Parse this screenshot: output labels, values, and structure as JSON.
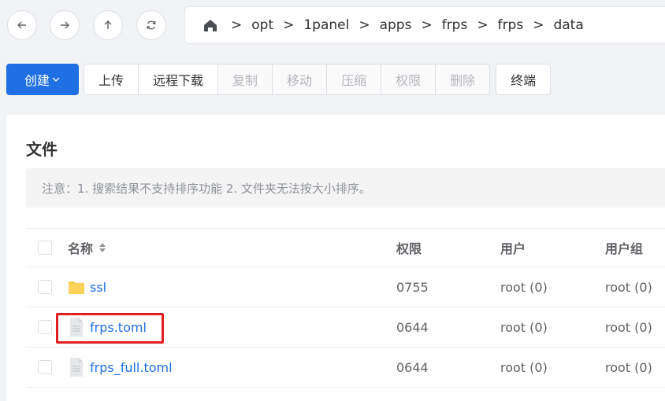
{
  "path": {
    "segments": [
      "opt",
      "1panel",
      "apps",
      "frps",
      "frps",
      "data"
    ],
    "separator": ">"
  },
  "toolbar": {
    "create_label": "创建",
    "buttons": [
      {
        "label": "上传",
        "disabled": false
      },
      {
        "label": "远程下载",
        "disabled": false
      },
      {
        "label": "复制",
        "disabled": true
      },
      {
        "label": "移动",
        "disabled": true
      },
      {
        "label": "压缩",
        "disabled": true
      },
      {
        "label": "权限",
        "disabled": true
      },
      {
        "label": "删除",
        "disabled": true
      }
    ],
    "terminal_label": "终端"
  },
  "main": {
    "title": "文件",
    "notice": "注意：1. 搜索结果不支持排序功能 2. 文件夹无法按大小排序。"
  },
  "table": {
    "headers": {
      "name": "名称",
      "permission": "权限",
      "user": "用户",
      "group": "用户组"
    },
    "rows": [
      {
        "name": "ssl",
        "type": "folder",
        "permission": "0755",
        "user": "root (0)",
        "group": "root (0)"
      },
      {
        "name": "frps.toml",
        "type": "file",
        "permission": "0644",
        "user": "root (0)",
        "group": "root (0)"
      },
      {
        "name": "frps_full.toml",
        "type": "file",
        "permission": "0644",
        "user": "root (0)",
        "group": "root (0)"
      }
    ]
  },
  "colors": {
    "accent": "#1f6fe5",
    "highlight": "#e02020",
    "folder": "#f7c948"
  }
}
